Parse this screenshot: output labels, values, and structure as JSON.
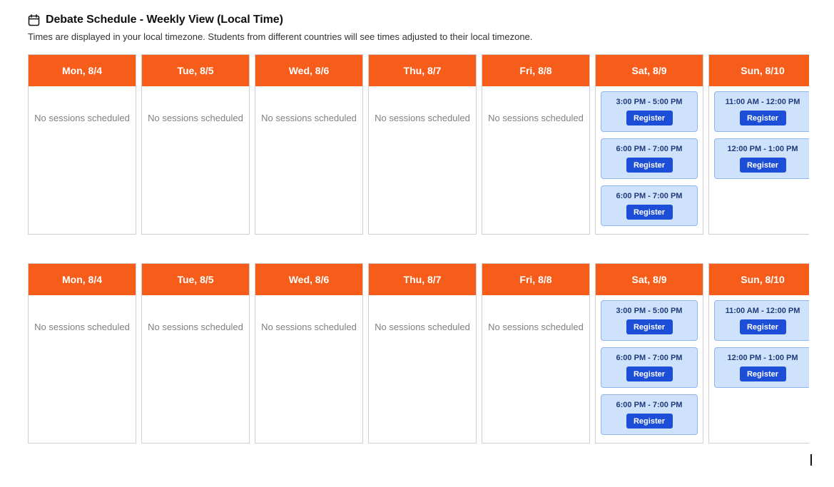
{
  "header": {
    "icon": "calendar-icon",
    "title": "Debate Schedule - Weekly View (Local Time)",
    "subtitle": "Times are displayed in your local timezone. Students from different countries will see times adjusted to their local timezone."
  },
  "colors": {
    "day_header": "#f65d1b",
    "slot_bg": "#cfe2fb",
    "slot_border": "#8fb6ee",
    "register_button": "#1d4ed8"
  },
  "empty_label": "No sessions scheduled",
  "register_label": "Register",
  "weeks": [
    {
      "days": [
        {
          "label": "Mon, 8/4",
          "slots": []
        },
        {
          "label": "Tue, 8/5",
          "slots": []
        },
        {
          "label": "Wed, 8/6",
          "slots": []
        },
        {
          "label": "Thu, 8/7",
          "slots": []
        },
        {
          "label": "Fri, 8/8",
          "slots": []
        },
        {
          "label": "Sat, 8/9",
          "slots": [
            "3:00 PM - 5:00 PM",
            "6:00 PM - 7:00 PM",
            "6:00 PM - 7:00 PM"
          ]
        },
        {
          "label": "Sun, 8/10",
          "slots": [
            "11:00 AM - 12:00 PM",
            "12:00 PM - 1:00 PM"
          ]
        }
      ]
    },
    {
      "days": [
        {
          "label": "Mon, 8/4",
          "slots": []
        },
        {
          "label": "Tue, 8/5",
          "slots": []
        },
        {
          "label": "Wed, 8/6",
          "slots": []
        },
        {
          "label": "Thu, 8/7",
          "slots": []
        },
        {
          "label": "Fri, 8/8",
          "slots": []
        },
        {
          "label": "Sat, 8/9",
          "slots": [
            "3:00 PM - 5:00 PM",
            "6:00 PM - 7:00 PM",
            "6:00 PM - 7:00 PM"
          ]
        },
        {
          "label": "Sun, 8/10",
          "slots": [
            "11:00 AM - 12:00 PM",
            "12:00 PM - 1:00 PM"
          ]
        }
      ]
    }
  ]
}
